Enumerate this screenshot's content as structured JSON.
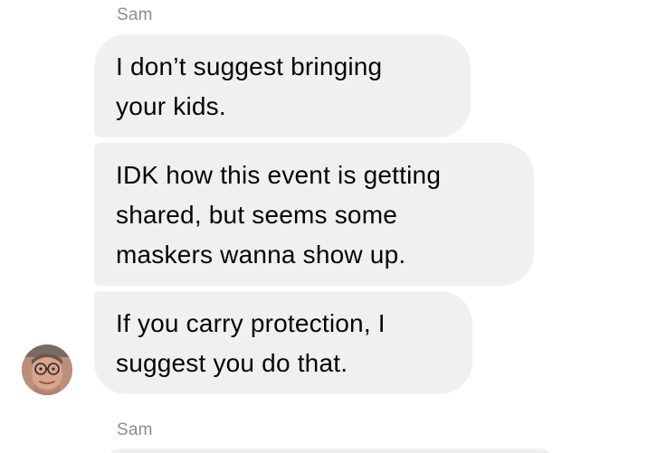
{
  "thread": {
    "sender_top": "Sam",
    "sender_bottom": "Sam",
    "messages": [
      {
        "lines": [
          "I don’t suggest bringing",
          "your kids."
        ]
      },
      {
        "lines": [
          "IDK how this event is getting",
          "shared, but seems some",
          "maskers wanna show up."
        ]
      },
      {
        "lines": [
          "If you carry protection, I",
          "suggest you do that."
        ]
      }
    ]
  },
  "colors": {
    "bubble_bg": "#f0f0f0",
    "text": "#050505",
    "sender_name": "#8a8d91",
    "background": "#ffffff"
  },
  "icons": {
    "avatar": "sender-avatar"
  }
}
